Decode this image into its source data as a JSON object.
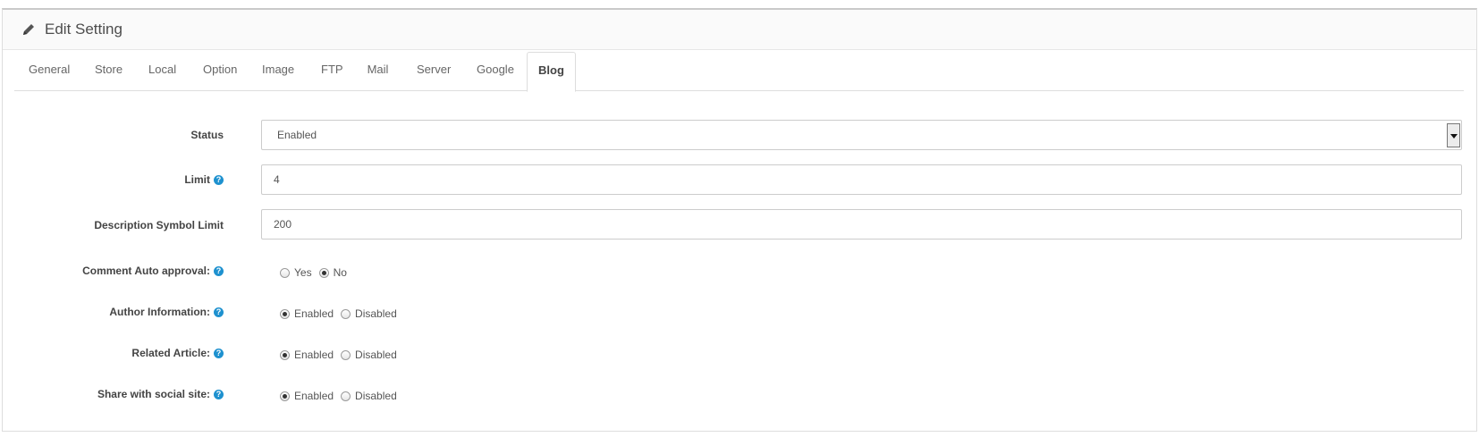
{
  "header": {
    "title": "Edit Setting",
    "icon": "pencil-icon"
  },
  "tabs": [
    {
      "label": "General",
      "active": false
    },
    {
      "label": "Store",
      "active": false
    },
    {
      "label": "Local",
      "active": false
    },
    {
      "label": "Option",
      "active": false
    },
    {
      "label": "Image",
      "active": false
    },
    {
      "label": "FTP",
      "active": false
    },
    {
      "label": "Mail",
      "active": false
    },
    {
      "label": "Server",
      "active": false
    },
    {
      "label": "Google",
      "active": false
    },
    {
      "label": "Blog",
      "active": true
    }
  ],
  "form": {
    "status": {
      "label": "Status",
      "value": "Enabled"
    },
    "limit": {
      "label": "Limit",
      "value": "4",
      "help": "?"
    },
    "description_limit": {
      "label": "Description Symbol Limit",
      "value": "200"
    },
    "comment_auto_approval": {
      "label": "Comment Auto approval:",
      "help": "?",
      "options": [
        "Yes",
        "No"
      ],
      "selected": "No"
    },
    "author_information": {
      "label": "Author Information:",
      "help": "?",
      "options": [
        "Enabled",
        "Disabled"
      ],
      "selected": "Enabled"
    },
    "related_article": {
      "label": "Related Article:",
      "help": "?",
      "options": [
        "Enabled",
        "Disabled"
      ],
      "selected": "Enabled"
    },
    "share_social": {
      "label": "Share with social site:",
      "help": "?",
      "options": [
        "Enabled",
        "Disabled"
      ],
      "selected": "Enabled"
    }
  },
  "colors": {
    "help_badge": "#1e91cf",
    "border": "#dddddd",
    "heading_bg": "#fafafa"
  }
}
